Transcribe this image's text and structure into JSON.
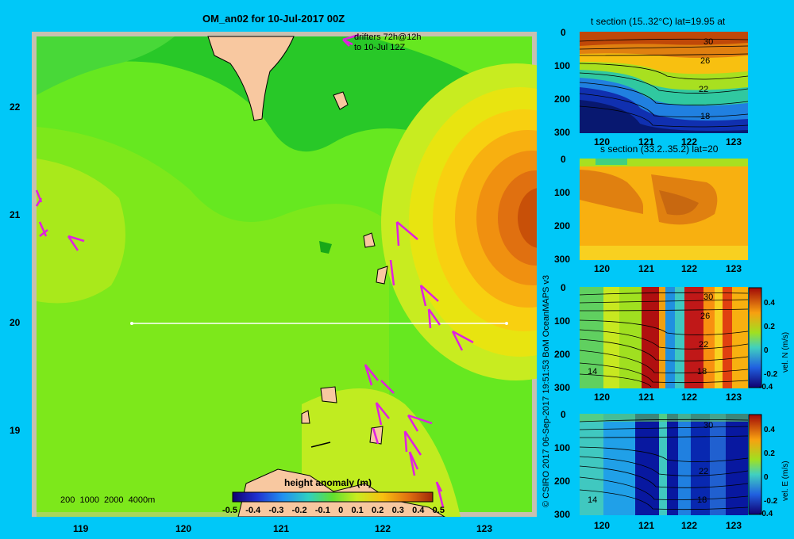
{
  "main_map": {
    "title": "OM_an02 for 10-Jul-2017 00Z",
    "drifters_line1": "drifters 72h@12h",
    "drifters_line2": "to 10-Jul 12Z",
    "depth_legend": "200  1000  2000  4000m",
    "colorbar_title": "height anomaly  (m)",
    "colorbar_ticks": [
      "-0.5",
      "-0.4",
      "-0.3",
      "-0.2",
      "-0.1",
      "0",
      "0.1",
      "0.2",
      "0.3",
      "0.4",
      "0.5"
    ],
    "x_ticks": [
      "119",
      "120",
      "121",
      "122",
      "123"
    ],
    "y_ticks": [
      "22",
      "21",
      "20",
      "19"
    ]
  },
  "credit": "© CSIRO 2017   06-Sep-2017 19:51:53 BoM OceanMAPS v3",
  "sections": [
    {
      "title": "t section (15..32°C) lat=19.95 at",
      "y_ticks": [
        "0",
        "100",
        "200",
        "300"
      ],
      "x_ticks": [
        "120",
        "121",
        "122",
        "123"
      ],
      "contour_labels": [
        "30",
        "26",
        "22",
        "18"
      ]
    },
    {
      "title": "s section (33.2..35.2) lat=20",
      "y_ticks": [
        "0",
        "100",
        "200",
        "300"
      ],
      "x_ticks": [
        "120",
        "121",
        "122",
        "123"
      ]
    },
    {
      "title": "",
      "y_ticks": [
        "0",
        "100",
        "200",
        "300"
      ],
      "x_ticks": [
        "120",
        "121",
        "122",
        "123"
      ],
      "contour_labels": [
        "30",
        "26",
        "22",
        "18",
        "14"
      ],
      "cbar_ticks": [
        "0.4",
        "0.2",
        "0",
        "-0.2",
        "-0.4"
      ],
      "cbar_label": "vel. N (m/s)"
    },
    {
      "title": "",
      "y_ticks": [
        "0",
        "100",
        "200",
        "300"
      ],
      "x_ticks": [
        "120",
        "121",
        "122",
        "123"
      ],
      "contour_labels": [
        "30",
        "22",
        "18",
        "14"
      ],
      "cbar_ticks": [
        "0.4",
        "0.2",
        "0",
        "-0.2",
        "-0.4"
      ],
      "cbar_label": "vel. E (m/s)"
    }
  ],
  "colors": {
    "background": "#00c8f8",
    "land": "#f8c8a0",
    "drifter": "#e020e0"
  }
}
